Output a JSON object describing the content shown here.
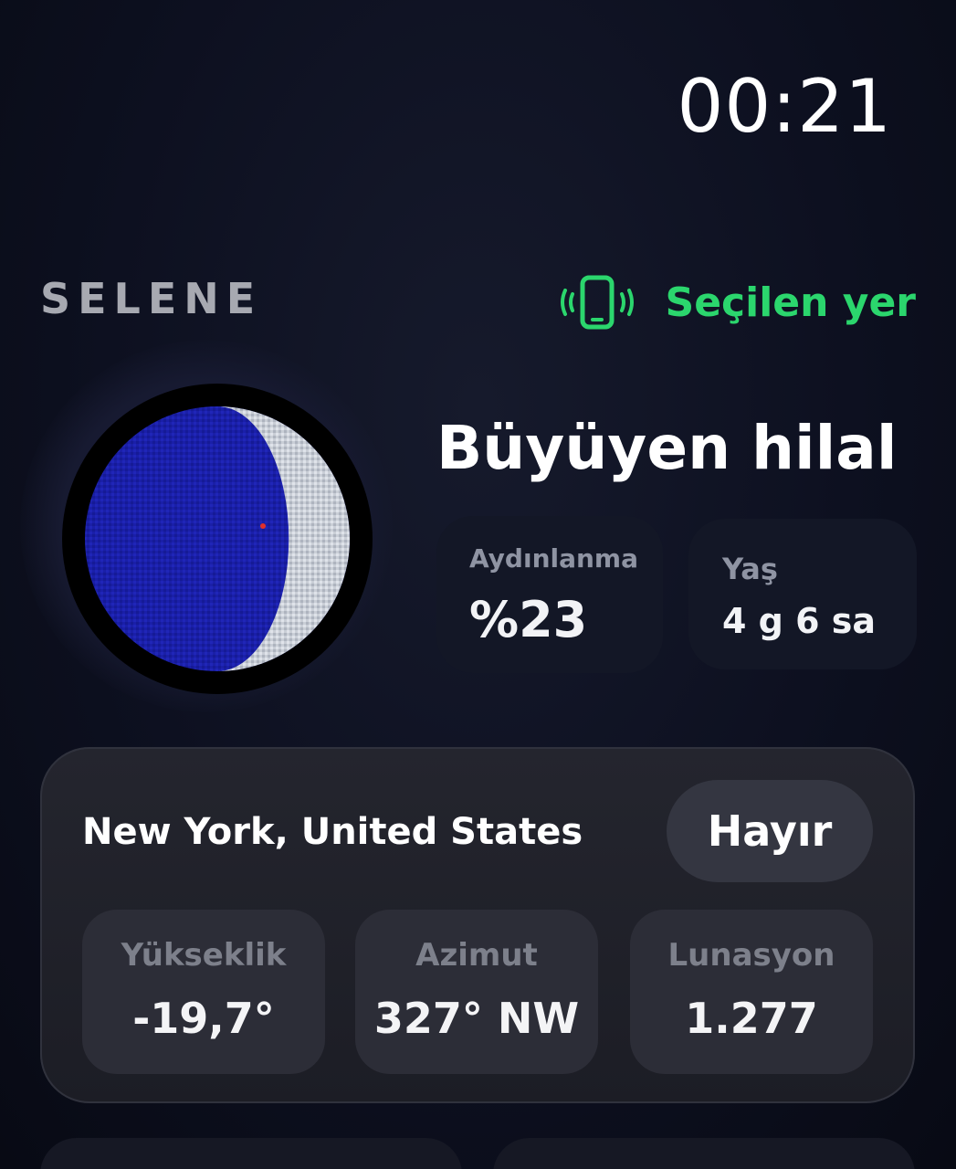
{
  "status": {
    "time": "00:21"
  },
  "header": {
    "brand": "SELENE",
    "location_mode_label": "Seçilen yer",
    "location_mode_icon": "phone-vibrate-icon",
    "accent_color": "#2bd66d"
  },
  "moon": {
    "phase_name": "Büyüyen hilal",
    "illumination_fraction": 0.23,
    "waxing": true,
    "dark_color": "#1a1fa8",
    "lit_color": "#c9ced6",
    "illumination": {
      "label": "Aydınlanma",
      "value": "%23"
    },
    "age": {
      "label": "Yaş",
      "value": "4 g 6 sa"
    }
  },
  "location_panel": {
    "city": "New York, United States",
    "toggle_label": "Hayır",
    "metrics": [
      {
        "label": "Yükseklik",
        "value": "-19,7°"
      },
      {
        "label": "Azimut",
        "value": "327° NW"
      },
      {
        "label": "Lunasyon",
        "value": "1.277"
      }
    ]
  }
}
